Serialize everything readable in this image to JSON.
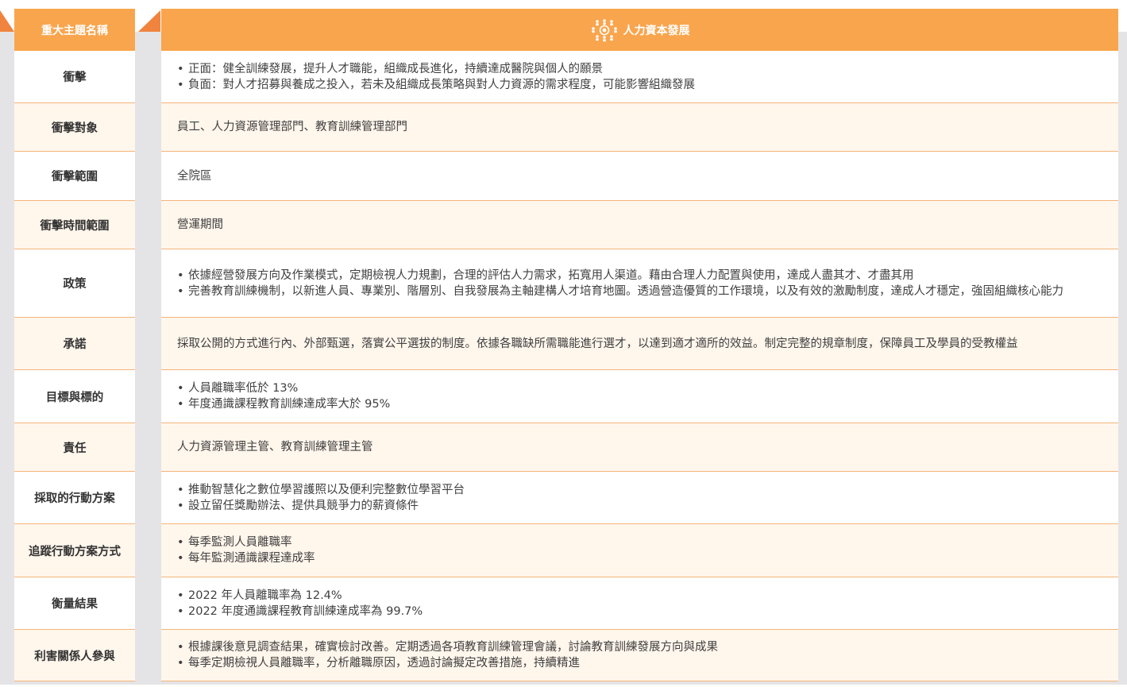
{
  "header": {
    "left_label": "重大主題名稱",
    "topic_title": "人力資本發展",
    "topic_icon": "people-network-icon"
  },
  "rows": [
    {
      "label": "衝擊",
      "height": 66,
      "items": [
        "正面：健全訓練發展，提升人才職能，組織成長進化，持續達成醫院與個人的願景",
        "負面：對人才招募與養成之投入，若未及組織成長策略與對人力資源的需求程度，可能影響組織發展"
      ]
    },
    {
      "label": "衝擊對象",
      "height": 61,
      "text": "員工、人力資源管理部門、教育訓練管理部門"
    },
    {
      "label": "衝擊範圍",
      "height": 62,
      "text": "全院區"
    },
    {
      "label": "衝擊時間範圍",
      "height": 61,
      "text": "營運期間"
    },
    {
      "label": "政策",
      "height": 86,
      "items": [
        "依據經營發展方向及作業模式，定期檢視人力規劃，合理的評估人力需求，拓寬用人渠道。藉由合理人力配置與使用，達成人盡其才、才盡其用",
        "完善教育訓練機制，以新進人員、專業別、階層別、自我發展為主軸建構人才培育地圖。透過營造優質的工作環境，以及有效的激勵制度，達成人才穩定，強固組織核心能力"
      ]
    },
    {
      "label": "承諾",
      "height": 66,
      "text": "採取公開的方式進行內、外部甄選，落實公平選拔的制度。依據各職缺所需職能進行選才，以達到適才適所的效益。制定完整的規章制度，保障員工及學員的受教權益"
    },
    {
      "label": "目標與標的",
      "height": 67,
      "items": [
        "人員離職率低於 13%",
        "年度通識課程教育訓練達成率大於 95%"
      ]
    },
    {
      "label": "責任",
      "height": 61,
      "text": "人力資源管理主管、教育訓練管理主管"
    },
    {
      "label": "採取的行動方案",
      "height": 66,
      "items": [
        "推動智慧化之數位學習護照以及便利完整數位學習平台",
        "設立留任獎勵辦法、提供具競爭力的薪資條件"
      ]
    },
    {
      "label": "追蹤行動方案方式",
      "height": 67,
      "items": [
        "每季監測人員離職率",
        "每年監測通識課程達成率"
      ]
    },
    {
      "label": "衡量結果",
      "height": 66,
      "items": [
        "2022 年人員離職率為 12.4%",
        "2022 年度通識課程教育訓練達成率為 99.7%"
      ]
    },
    {
      "label": "利害關係人參與",
      "height": 65,
      "items": [
        "根據課後意見調查結果，確實檢討改善。定期透過各項教育訓練管理會議，討論教育訓練發展方向與成果",
        "每季定期檢視人員離職率，分析離職原因，透過討論擬定改善措施，持續精進"
      ]
    }
  ]
}
